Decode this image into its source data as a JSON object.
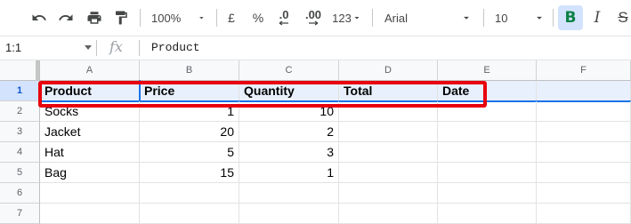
{
  "toolbar": {
    "zoom": "100%",
    "currency": "£",
    "percent": "%",
    "decrease_decimals": ".0",
    "increase_decimals": ".00",
    "more_formats": "123",
    "font": "Arial",
    "font_size": "10",
    "bold": "B",
    "italic": "I",
    "strikethrough": "S"
  },
  "formula_bar": {
    "name_box": "1:1",
    "fx": "fx",
    "value": "Product"
  },
  "columns": [
    "A",
    "B",
    "C",
    "D",
    "E",
    "F"
  ],
  "rows": [
    "1",
    "2",
    "3",
    "4",
    "5",
    "6",
    "7"
  ],
  "cells": {
    "header": [
      "Product",
      "Price",
      "Quantity",
      "Total",
      "Date"
    ],
    "r2": [
      "Socks",
      "1",
      "10"
    ],
    "r3": [
      "Jacket",
      "20",
      "2"
    ],
    "r4": [
      "Hat",
      "5",
      "3"
    ],
    "r5": [
      "Bag",
      "15",
      "1"
    ]
  },
  "colors": {
    "highlight_border": "#e8000d",
    "selection": "#1a73e8",
    "bold_active": "#0b8043"
  }
}
